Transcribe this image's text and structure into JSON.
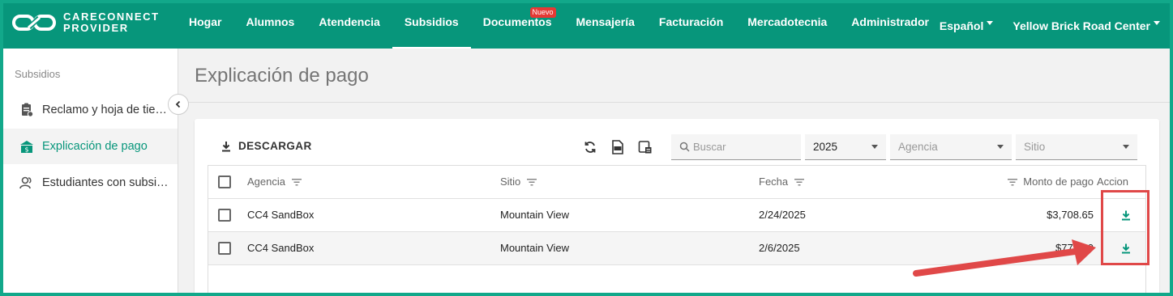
{
  "app": {
    "logo_line1": "CARECONNECT",
    "logo_line2": "PROVIDER",
    "brand_color": "#07967b",
    "frame_color": "#12a88a"
  },
  "nav": {
    "items": [
      {
        "label": "Hogar"
      },
      {
        "label": "Alumnos"
      },
      {
        "label": "Atendencia"
      },
      {
        "label": "Subsidios"
      },
      {
        "label": "Documentos",
        "badge": "Nuevo"
      },
      {
        "label": "Mensajería"
      },
      {
        "label": "Facturación"
      },
      {
        "label": "Mercadotecnia"
      },
      {
        "label": "Administrador"
      }
    ],
    "active": "Subsidios",
    "language": "Español",
    "center": "Yellow Brick Road Center"
  },
  "sidebar": {
    "title": "Subsidios",
    "items": [
      {
        "label": "Reclamo y hoja de tie…",
        "icon": "clipboard-icon"
      },
      {
        "label": "Explicación de pago",
        "icon": "payment-icon"
      },
      {
        "label": "Estudiantes con subsi…",
        "icon": "students-icon"
      }
    ],
    "active_index": 1
  },
  "page": {
    "title": "Explicación de pago"
  },
  "toolbar": {
    "download_label": "DESCARGAR",
    "search_placeholder": "Buscar",
    "year": "2025",
    "agency_placeholder": "Agencia",
    "site_placeholder": "Sitio"
  },
  "table": {
    "columns": {
      "agency": "Agencia",
      "site": "Sitio",
      "date": "Fecha",
      "amount": "Monto de pago",
      "action": "Accion"
    },
    "rows": [
      {
        "agency": "CC4 SandBox",
        "site": "Mountain View",
        "date": "2/24/2025",
        "amount": "$3,708.65"
      },
      {
        "agency": "CC4 SandBox",
        "site": "Mountain View",
        "date": "2/6/2025",
        "amount": "$778.90"
      }
    ]
  },
  "annotation": {
    "highlight_color": "#e04848"
  }
}
